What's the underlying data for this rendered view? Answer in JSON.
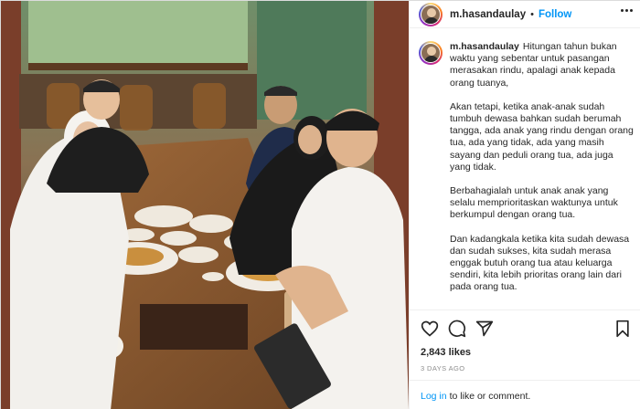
{
  "post": {
    "username": "m.hasandaulay",
    "separator": "•",
    "follow_label": "Follow",
    "caption": {
      "username": "m.hasandaulay",
      "paragraphs": [
        "Hitungan tahun bukan waktu yang sebentar untuk pasangan merasakan rindu, apalagi anak kepada orang tuanya,",
        "Akan tetapi, ketika anak-anak sudah tumbuh dewasa bahkan sudah berumah tangga, ada anak yang rindu dengan orang tua, ada yang tidak, ada yang masih sayang dan peduli orang tua, ada juga yang tidak.",
        "Berbahagialah untuk anak anak yang selalu memprioritaskan waktunya untuk berkumpul dengan orang tua.",
        "Dan kadangkala ketika kita sudah dewasa dan sudah sukses, kita sudah merasa enggak butuh orang tua atau keluarga sendiri, kita lebih prioritas orang lain dari pada orang tua."
      ]
    },
    "likes": "2,843 likes",
    "timestamp": "3 DAYS AGO",
    "login_link": "Log in",
    "login_suffix": "to like or comment."
  },
  "icons": {
    "more": "more-options-icon",
    "like": "heart-icon",
    "comment": "comment-icon",
    "share": "share-icon",
    "save": "bookmark-icon"
  },
  "colors": {
    "link": "#0095f6",
    "text": "#262626",
    "muted": "#8e8e8e",
    "border": "#efefef"
  }
}
